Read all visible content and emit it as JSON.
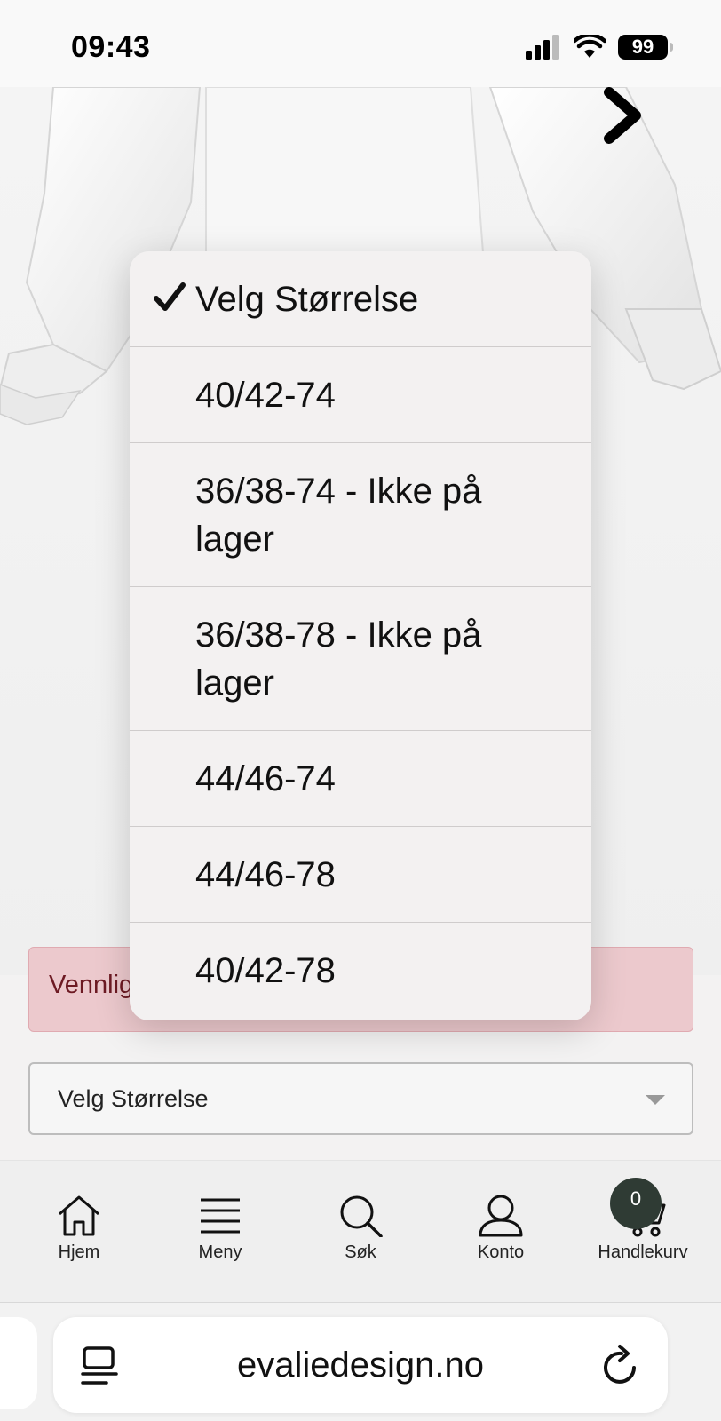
{
  "status_bar": {
    "time": "09:43",
    "battery": "99",
    "icons": [
      "signal-icon",
      "wifi-icon",
      "battery-icon"
    ]
  },
  "product": {
    "image_icon": "product-image-blouse",
    "next_icon": "chevron-right-icon"
  },
  "error_banner": {
    "text": "Vennlig"
  },
  "size_select": {
    "value": "Velg Størrelse"
  },
  "dropdown": {
    "options": [
      {
        "label": "Velg Størrelse",
        "selected": true
      },
      {
        "label": "40/42-74"
      },
      {
        "label": "36/38-74 - Ikke på lager"
      },
      {
        "label": "36/38-78 - Ikke på lager"
      },
      {
        "label": "44/46-74"
      },
      {
        "label": "44/46-78"
      },
      {
        "label": "40/42-78"
      }
    ]
  },
  "bottom_nav": {
    "items": [
      {
        "label": "Hjem",
        "icon": "home-icon"
      },
      {
        "label": "Meny",
        "icon": "menu-icon"
      },
      {
        "label": "Søk",
        "icon": "search-icon"
      },
      {
        "label": "Konto",
        "icon": "user-icon"
      },
      {
        "label": "Handlekurv",
        "icon": "cart-icon"
      }
    ],
    "cart_count": "0"
  },
  "browser": {
    "url": "evaliedesign.no",
    "icons": [
      "tabs-icon",
      "reload-icon"
    ]
  },
  "colors": {
    "error_bg": "#ecc9cd",
    "error_text": "#6d1a23",
    "badge_bg": "#2f3b34",
    "dropdown_bg": "#f3f1f1"
  }
}
